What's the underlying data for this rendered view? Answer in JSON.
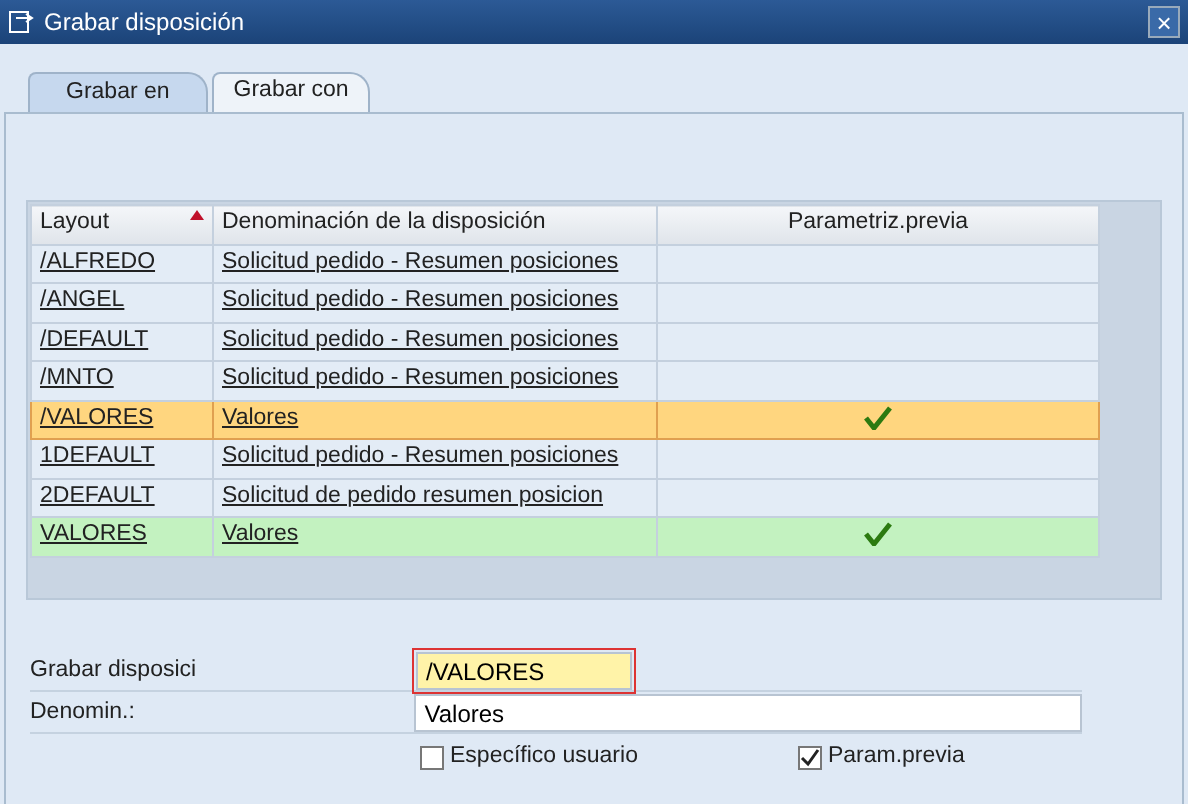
{
  "window": {
    "title": "Grabar disposición",
    "close": "×"
  },
  "tabs": [
    {
      "label": "Grabar en",
      "selected": true
    },
    {
      "label": "Grabar con",
      "selected": false
    }
  ],
  "table": {
    "columns": [
      "Layout",
      "Denominación de la disposición",
      "Parametriz.previa"
    ],
    "rows": [
      {
        "layout": "/ALFREDO",
        "name": "Solicitud pedido - Resumen posiciones",
        "preview": false,
        "selected": false,
        "highlighted": false
      },
      {
        "layout": "/ANGEL",
        "name": "Solicitud pedido - Resumen posiciones",
        "preview": false,
        "selected": false,
        "highlighted": false
      },
      {
        "layout": "/DEFAULT",
        "name": "Solicitud pedido - Resumen posiciones",
        "preview": false,
        "selected": false,
        "highlighted": false
      },
      {
        "layout": "/MNTO",
        "name": "Solicitud pedido - Resumen posiciones",
        "preview": false,
        "selected": false,
        "highlighted": false
      },
      {
        "layout": "/VALORES",
        "name": "Valores",
        "preview": true,
        "selected": true,
        "highlighted": false
      },
      {
        "layout": "1DEFAULT",
        "name": "Solicitud pedido - Resumen posiciones",
        "preview": false,
        "selected": false,
        "highlighted": false
      },
      {
        "layout": "2DEFAULT",
        "name": "Solicitud de pedido resumen posicion",
        "preview": false,
        "selected": false,
        "highlighted": false
      },
      {
        "layout": "VALORES",
        "name": "Valores",
        "preview": true,
        "selected": false,
        "highlighted": true
      }
    ]
  },
  "form": {
    "layout_label": "Grabar disposici",
    "layout_value": "/VALORES",
    "layout_focused": true,
    "name_label": "Denomin.:",
    "name_value": "Valores",
    "checkboxes": [
      {
        "label": "Específico usuario",
        "checked": false
      },
      {
        "label": "Param.previa",
        "checked": true
      }
    ]
  }
}
